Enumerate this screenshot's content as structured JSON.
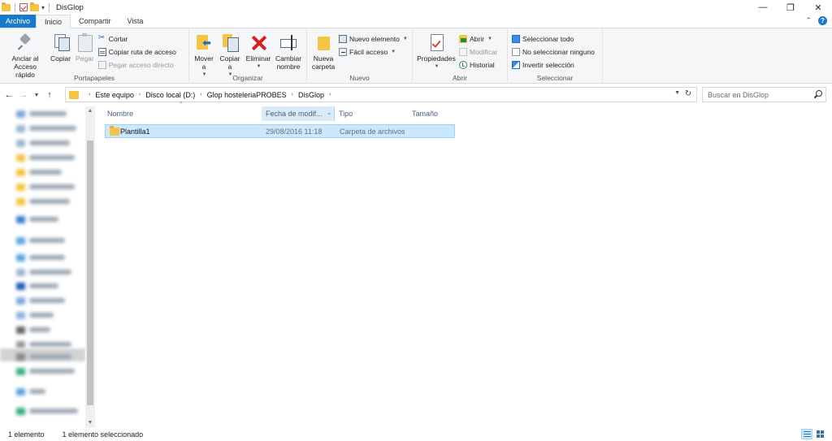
{
  "window": {
    "title": "DisGlop",
    "minimize": "—",
    "maximize": "❐",
    "close": "✕"
  },
  "tabs": [
    {
      "label": "Archivo"
    },
    {
      "label": "Inicio"
    },
    {
      "label": "Compartir"
    },
    {
      "label": "Vista"
    }
  ],
  "ribbon": {
    "portapapeles": {
      "label": "Portapapeles",
      "pin": "Anclar al Acceso rápido",
      "copy": "Copiar",
      "paste": "Pegar",
      "cut": "Cortar",
      "copy_path": "Copiar ruta de acceso",
      "paste_shortcut": "Pegar acceso directo"
    },
    "organizar": {
      "label": "Organizar",
      "move_to": "Mover a",
      "copy_to": "Copiar a",
      "delete": "Eliminar",
      "rename": "Cambiar nombre"
    },
    "nuevo": {
      "label": "Nuevo",
      "new_folder": "Nueva carpeta",
      "new_item": "Nuevo elemento",
      "easy_access": "Fácil acceso"
    },
    "abrir": {
      "label": "Abrir",
      "properties": "Propiedades",
      "open": "Abrir",
      "edit": "Modificar",
      "history": "Historial"
    },
    "seleccionar": {
      "label": "Seleccionar",
      "select_all": "Seleccionar todo",
      "select_none": "No seleccionar ninguno",
      "invert": "Invertir selección"
    }
  },
  "address": {
    "crumbs": [
      "Este equipo",
      "Disco local (D:)",
      "Glop hosteleriaPROBES",
      "DisGlop"
    ]
  },
  "search": {
    "placeholder": "Buscar en DisGlop"
  },
  "columns": {
    "name": "Nombre",
    "date": "Fecha de modif...",
    "type": "Tipo",
    "size": "Tamaño"
  },
  "files": [
    {
      "name": "Plantilla1",
      "date": "29/08/2016 11:18",
      "type": "Carpeta de archivos",
      "size": ""
    }
  ],
  "status": {
    "count": "1 elemento",
    "selected": "1 elemento seleccionado"
  },
  "colors": {
    "accent": "#1979ca",
    "selection": "#cce8ff",
    "folder": "#f4c542"
  }
}
